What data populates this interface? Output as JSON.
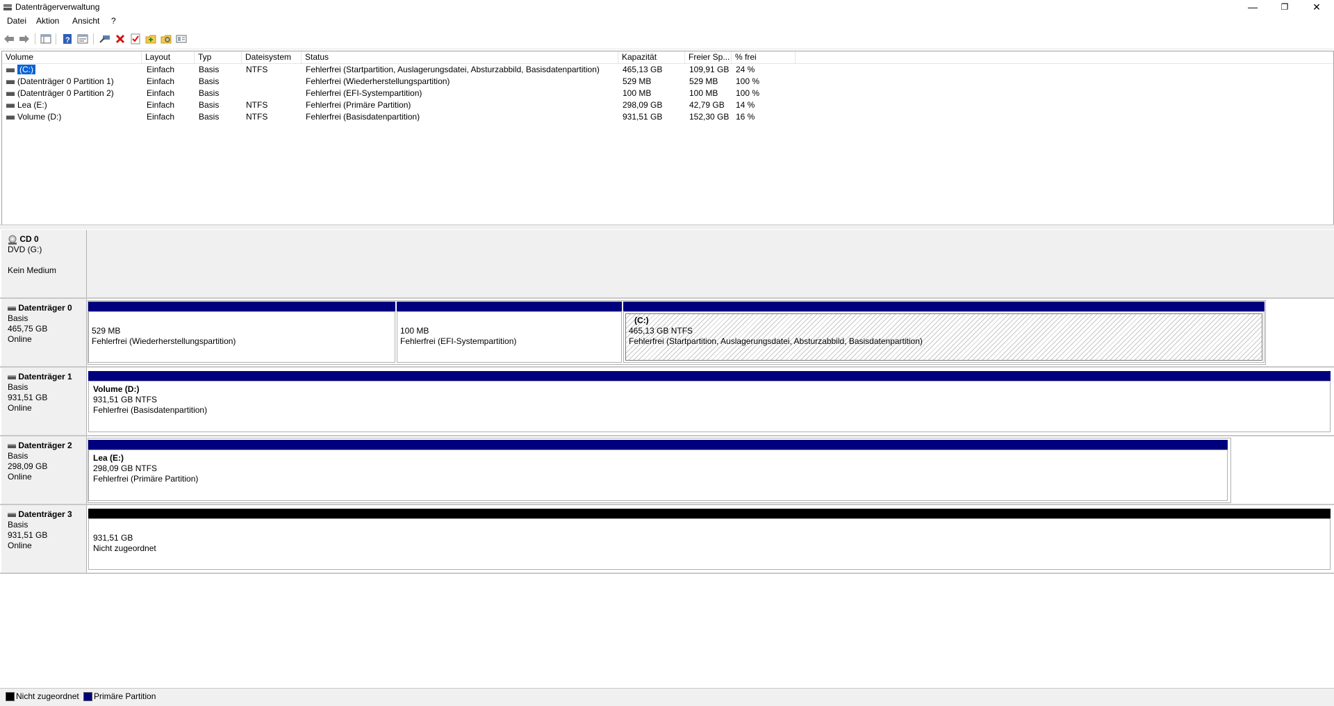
{
  "window": {
    "title": "Datenträgerverwaltung",
    "minimize_symbol": "—",
    "restore_symbol": "❐",
    "close_symbol": "✕"
  },
  "menu": [
    "Datei",
    "Aktion",
    "Ansicht",
    "?"
  ],
  "toolbar": {
    "icons": [
      "back-arrow-icon",
      "forward-arrow-icon",
      "console-tree-icon",
      "help-icon",
      "properties-icon",
      "connect-icon",
      "delete-icon",
      "check-icon",
      "new-folder-icon",
      "open-folder-icon",
      "view-icon"
    ]
  },
  "volume_table": {
    "columns": [
      "Volume",
      "Layout",
      "Typ",
      "Dateisystem",
      "Status",
      "Kapazität",
      "Freier Sp...",
      "% frei"
    ],
    "rows": [
      {
        "volume": "(C:)",
        "layout": "Einfach",
        "typ": "Basis",
        "fs": "NTFS",
        "status": "Fehlerfrei (Startpartition, Auslagerungsdatei, Absturzabbild, Basisdatenpartition)",
        "capacity": "465,13 GB",
        "free": "109,91 GB",
        "pct": "24 %",
        "selected": true
      },
      {
        "volume": "(Datenträger 0 Partition 1)",
        "layout": "Einfach",
        "typ": "Basis",
        "fs": "",
        "status": "Fehlerfrei (Wiederherstellungspartition)",
        "capacity": "529 MB",
        "free": "529 MB",
        "pct": "100 %",
        "selected": false
      },
      {
        "volume": "(Datenträger 0 Partition 2)",
        "layout": "Einfach",
        "typ": "Basis",
        "fs": "",
        "status": "Fehlerfrei (EFI-Systempartition)",
        "capacity": "100 MB",
        "free": "100 MB",
        "pct": "100 %",
        "selected": false
      },
      {
        "volume": "Lea (E:)",
        "layout": "Einfach",
        "typ": "Basis",
        "fs": "NTFS",
        "status": "Fehlerfrei (Primäre Partition)",
        "capacity": "298,09 GB",
        "free": "42,79 GB",
        "pct": "14 %",
        "selected": false
      },
      {
        "volume": "Volume (D:)",
        "layout": "Einfach",
        "typ": "Basis",
        "fs": "NTFS",
        "status": "Fehlerfrei (Basisdatenpartition)",
        "capacity": "931,51 GB",
        "free": "152,30 GB",
        "pct": "16 %",
        "selected": false
      }
    ]
  },
  "disks": {
    "cd0": {
      "name": "CD 0",
      "line1": "DVD (G:)",
      "line2": "Kein Medium"
    },
    "disk0": {
      "name": "Datenträger 0",
      "type": "Basis",
      "size": "465,75 GB",
      "state": "Online",
      "partitions": [
        {
          "name": "",
          "size": "529 MB",
          "status": "Fehlerfrei (Wiederherstellungspartition)"
        },
        {
          "name": "",
          "size": "100 MB",
          "status": "Fehlerfrei (EFI-Systempartition)"
        },
        {
          "name": "(C:)",
          "size": "465,13 GB NTFS",
          "status": "Fehlerfrei (Startpartition, Auslagerungsdatei, Absturzabbild, Basisdatenpartition)"
        }
      ]
    },
    "disk1": {
      "name": "Datenträger 1",
      "type": "Basis",
      "size": "931,51 GB",
      "state": "Online",
      "partitions": [
        {
          "name": "Volume  (D:)",
          "size": "931,51 GB NTFS",
          "status": "Fehlerfrei (Basisdatenpartition)"
        }
      ]
    },
    "disk2": {
      "name": "Datenträger 2",
      "type": "Basis",
      "size": "298,09 GB",
      "state": "Online",
      "partitions": [
        {
          "name": "Lea  (E:)",
          "size": "298,09 GB NTFS",
          "status": "Fehlerfrei (Primäre Partition)"
        }
      ]
    },
    "disk3": {
      "name": "Datenträger 3",
      "type": "Basis",
      "size": "931,51 GB",
      "state": "Online",
      "partitions": [
        {
          "name": "",
          "size": "931,51 GB",
          "status": "Nicht zugeordnet"
        }
      ]
    }
  },
  "legend": {
    "unallocated": "Nicht zugeordnet",
    "primary": "Primäre Partition",
    "colors": {
      "unallocated": "#000000",
      "primary": "#00007f"
    }
  }
}
